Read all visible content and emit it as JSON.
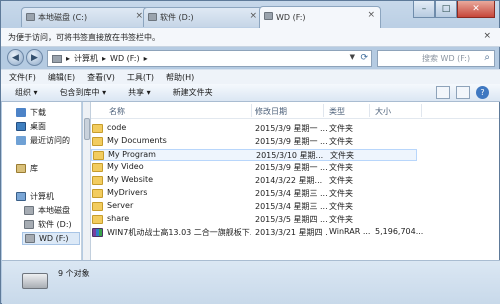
{
  "tabs": [
    {
      "label": "本地磁盘 (C:)",
      "close": "×"
    },
    {
      "label": "软件 (D:)",
      "close": "×"
    },
    {
      "label": "WD (F:)",
      "close": "×"
    }
  ],
  "window_controls": {
    "minimize": "–",
    "maximize": "□",
    "close": "✕"
  },
  "bookmark_bar": {
    "text": "为便于访问，可将书签直接放在书签栏中。",
    "close": "×"
  },
  "nav": {
    "back": "◀",
    "forward": "▶"
  },
  "address": {
    "crumbs": [
      "计算机",
      "WD (F:)"
    ],
    "sep": "▸"
  },
  "search": {
    "placeholder": "搜索 WD (F:)",
    "icon": "search-icon"
  },
  "menu": [
    "文件(F)",
    "编辑(E)",
    "查看(V)",
    "工具(T)",
    "帮助(H)"
  ],
  "commands": [
    "组织 ▾",
    "包含到库中 ▾",
    "共享 ▾",
    "新建文件夹"
  ],
  "help_label": "?",
  "sidebar": {
    "items": [
      {
        "label": "下载",
        "icon": "downloads-icon"
      },
      {
        "label": "桌面",
        "icon": "desktop-icon"
      },
      {
        "label": "最近访问的",
        "icon": "recent-places-icon"
      },
      {
        "label": "库",
        "icon": "library-icon"
      },
      {
        "label": "计算机",
        "icon": "computer-icon"
      },
      {
        "label": "本地磁盘",
        "icon": "drive-icon"
      },
      {
        "label": "软件 (D:)",
        "icon": "drive-icon"
      },
      {
        "label": "WD (F:)",
        "icon": "drive-icon"
      }
    ]
  },
  "columns": {
    "name": "名称",
    "date": "修改日期",
    "type": "类型",
    "size": "大小"
  },
  "files": [
    {
      "name": "code",
      "date": "2015/3/9 星期一 ...",
      "type": "文件夹",
      "size": ""
    },
    {
      "name": "My Documents",
      "date": "2015/3/9 星期一 ...",
      "type": "文件夹",
      "size": ""
    },
    {
      "name": "My Program",
      "date": "2015/3/10 星期...",
      "type": "文件夹",
      "size": ""
    },
    {
      "name": "My Video",
      "date": "2015/3/9 星期一 ...",
      "type": "文件夹",
      "size": ""
    },
    {
      "name": "My Website",
      "date": "2014/3/22 星期...",
      "type": "文件夹",
      "size": ""
    },
    {
      "name": "MyDrivers",
      "date": "2015/3/4 星期三 ...",
      "type": "文件夹",
      "size": ""
    },
    {
      "name": "Server",
      "date": "2015/3/4 星期三 ...",
      "type": "文件夹",
      "size": ""
    },
    {
      "name": "share",
      "date": "2015/3/5 星期四 ...",
      "type": "文件夹",
      "size": ""
    },
    {
      "name": "WIN7机动战士高13.03 二合一旗舰板下...",
      "date": "2013/3/21 星期四 ...",
      "type": "WinRAR ...",
      "size": "5,196,704..."
    }
  ],
  "status": {
    "count": "9 个对象"
  }
}
